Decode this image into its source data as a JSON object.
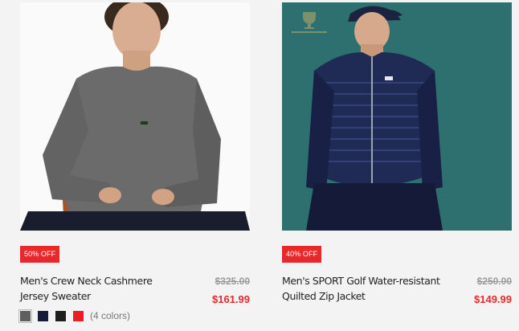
{
  "products": [
    {
      "badge": "50% OFF",
      "name": "Men's Crew Neck Cashmere Jersey Sweater",
      "old_price": "$325.00",
      "price": "$161.99",
      "swatches": [
        "#5f5f5f",
        "#161b3a",
        "#1e1e1e",
        "#ee1c25"
      ],
      "colors_label": "(4 colors)"
    },
    {
      "badge": "40% OFF",
      "name": "Men's SPORT Golf Water-resistant Quilted Zip Jacket",
      "old_price": "$250.00",
      "price": "$149.99"
    }
  ]
}
